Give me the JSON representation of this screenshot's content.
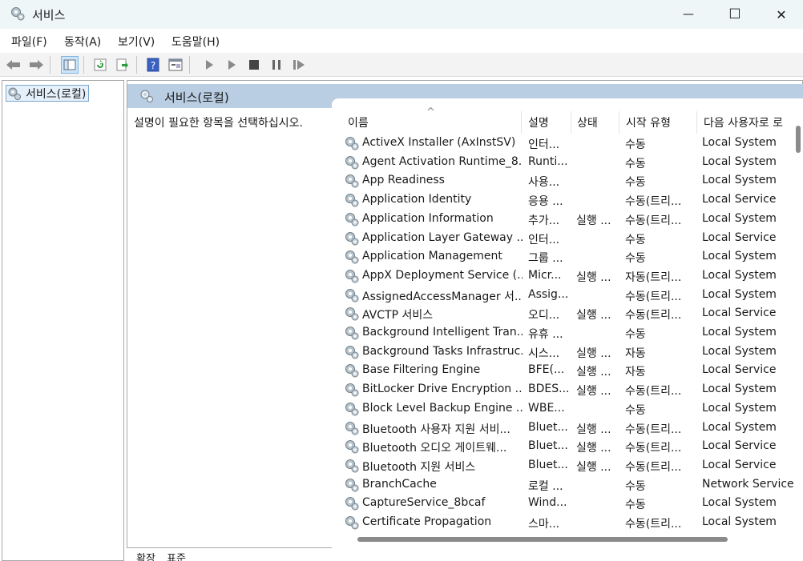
{
  "window": {
    "title": "서비스",
    "min_glyph": "—",
    "max_glyph": "☐",
    "close_glyph": "✕"
  },
  "menu": [
    "파일(F)",
    "동작(A)",
    "보기(V)",
    "도움말(H)"
  ],
  "tree": {
    "root": "서비스(로컬)"
  },
  "pane": {
    "title": "서비스(로컬)",
    "description": "설명이 필요한 항목을 선택하십시오.",
    "sort_glyph": "^"
  },
  "columns": [
    "이름",
    "설명",
    "상태",
    "시작 유형",
    "다음 사용자로 로"
  ],
  "rows": [
    {
      "name": "ActiveX Installer (AxInstSV)",
      "desc": "인터...",
      "status": "",
      "start": "수동",
      "logon": "Local System"
    },
    {
      "name": "Agent Activation Runtime_8...",
      "desc": "Runti...",
      "status": "",
      "start": "수동",
      "logon": "Local System"
    },
    {
      "name": "App Readiness",
      "desc": "사용...",
      "status": "",
      "start": "수동",
      "logon": "Local System"
    },
    {
      "name": "Application Identity",
      "desc": "응용 ...",
      "status": "",
      "start": "수동(트리...",
      "logon": "Local Service"
    },
    {
      "name": "Application Information",
      "desc": "추가...",
      "status": "실행 ...",
      "start": "수동(트리...",
      "logon": "Local System"
    },
    {
      "name": "Application Layer Gateway ...",
      "desc": "인터...",
      "status": "",
      "start": "수동",
      "logon": "Local Service"
    },
    {
      "name": "Application Management",
      "desc": "그룹 ...",
      "status": "",
      "start": "수동",
      "logon": "Local System"
    },
    {
      "name": "AppX Deployment Service (...",
      "desc": "Micr...",
      "status": "실행 ...",
      "start": "자동(트리...",
      "logon": "Local System"
    },
    {
      "name": "AssignedAccessManager 서...",
      "desc": "Assig...",
      "status": "",
      "start": "수동(트리...",
      "logon": "Local System"
    },
    {
      "name": "AVCTP 서비스",
      "desc": "오디...",
      "status": "실행 ...",
      "start": "수동(트리...",
      "logon": "Local Service"
    },
    {
      "name": "Background Intelligent Tran...",
      "desc": "유휴 ...",
      "status": "",
      "start": "수동",
      "logon": "Local System"
    },
    {
      "name": "Background Tasks Infrastruc...",
      "desc": "시스...",
      "status": "실행 ...",
      "start": "자동",
      "logon": "Local System"
    },
    {
      "name": "Base Filtering Engine",
      "desc": "BFE(...",
      "status": "실행 ...",
      "start": "자동",
      "logon": "Local Service"
    },
    {
      "name": "BitLocker Drive Encryption ...",
      "desc": "BDES...",
      "status": "실행 ...",
      "start": "수동(트리...",
      "logon": "Local System"
    },
    {
      "name": "Block Level Backup Engine ...",
      "desc": "WBE...",
      "status": "",
      "start": "수동",
      "logon": "Local System"
    },
    {
      "name": "Bluetooth 사용자 지원 서비...",
      "desc": "Bluet...",
      "status": "실행 ...",
      "start": "수동(트리...",
      "logon": "Local System"
    },
    {
      "name": "Bluetooth 오디오 게이트웨...",
      "desc": "Bluet...",
      "status": "실행 ...",
      "start": "수동(트리...",
      "logon": "Local Service"
    },
    {
      "name": "Bluetooth 지원 서비스",
      "desc": "Bluet...",
      "status": "실행 ...",
      "start": "수동(트리...",
      "logon": "Local Service"
    },
    {
      "name": "BranchCache",
      "desc": "로컬 ...",
      "status": "",
      "start": "수동",
      "logon": "Network Service"
    },
    {
      "name": "CaptureService_8bcaf",
      "desc": "Wind...",
      "status": "",
      "start": "수동",
      "logon": "Local System"
    },
    {
      "name": "Certificate Propagation",
      "desc": "스마...",
      "status": "",
      "start": "수동(트리...",
      "logon": "Local System"
    }
  ],
  "bottom_tabs": [
    "확장",
    "표준"
  ],
  "colors": {
    "titlebar": "#eef6f7",
    "pane_header": "#b9cde3",
    "selection": "#e5f0fb"
  }
}
